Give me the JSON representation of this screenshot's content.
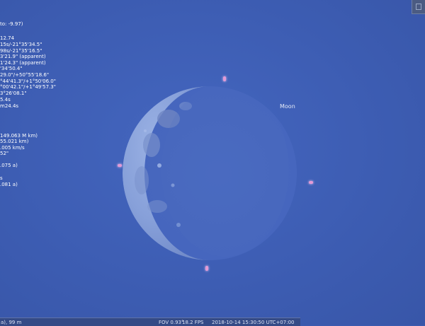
{
  "window": {
    "corner_button_icon": "window-restore-icon"
  },
  "object_info": {
    "lines": [
      " to:  -9.97)",
      "12.74",
      "15s/-21°35'34.5\"",
      "98s/-21°35'16.5\"",
      "3'21.9\" (apparent)",
      "1'24.3\" (apparent)",
      "'34'50.4\"",
      "29.0\"/+50°55'18.6\"",
      "°44'41.3\"/+1°50'06.0\"",
      "°00'42.1\"/+1°49'57.3\"",
      "3°26'08.1\"",
      "5.4s",
      "m24.4s",
      "",
      "",
      "149.063 M km)",
      "55.021 km)",
      ".005 km/s",
      "52\"",
      "",
      ".075 a)",
      "",
      "s",
      ".081 a)"
    ]
  },
  "sky": {
    "moon_label": "Moon",
    "marker_color": "#e39ad6"
  },
  "statusbar": {
    "location": "a), 99 m",
    "fov": "FOV 0.93°",
    "fps": "18.2 FPS",
    "datetime": "2018-10-14 15:30:50 UTC+07:00"
  }
}
